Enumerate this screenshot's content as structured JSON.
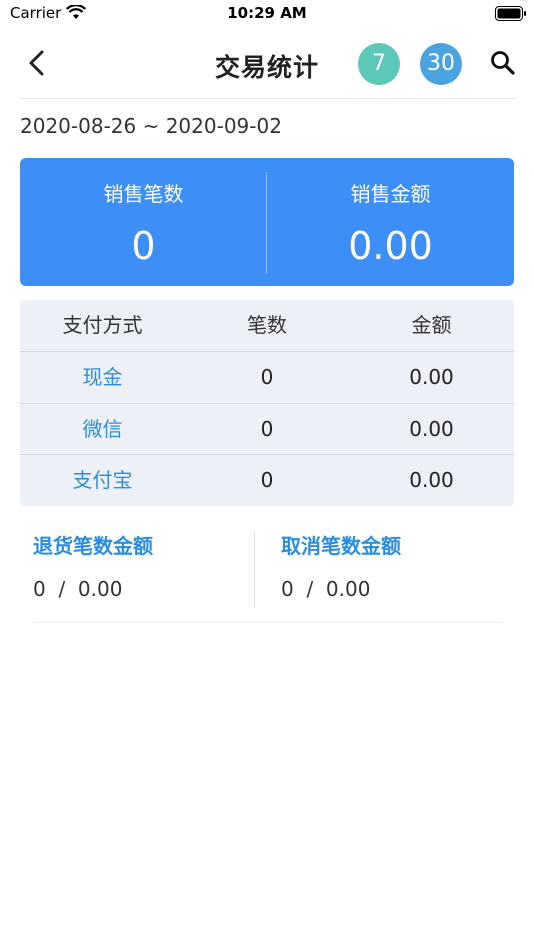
{
  "status_bar": {
    "carrier": "Carrier",
    "time": "10:29 AM"
  },
  "nav": {
    "title": "交易统计",
    "back_icon": "chevron-left-icon",
    "quick_range_7": "7",
    "quick_range_30": "30",
    "search_icon": "search-icon",
    "colors": {
      "btn_7": "#5cc8b8",
      "btn_30": "#4aa3df"
    }
  },
  "date_range": "2020-08-26 ~ 2020-09-02",
  "summary": {
    "color": "#3d8ef7",
    "sales_count_label": "销售笔数",
    "sales_count_value": "0",
    "sales_amount_label": "销售金额",
    "sales_amount_value": "0.00"
  },
  "payment_table": {
    "columns": [
      "支付方式",
      "笔数",
      "金额"
    ],
    "rows": [
      {
        "method": "现金",
        "count": "0",
        "amount": "0.00"
      },
      {
        "method": "微信",
        "count": "0",
        "amount": "0.00"
      },
      {
        "method": "支付宝",
        "count": "0",
        "amount": "0.00"
      }
    ]
  },
  "refund": {
    "title": "退货笔数金额",
    "count": "0",
    "amount": "0.00"
  },
  "cancel": {
    "title": "取消笔数金额",
    "count": "0",
    "amount": "0.00"
  }
}
